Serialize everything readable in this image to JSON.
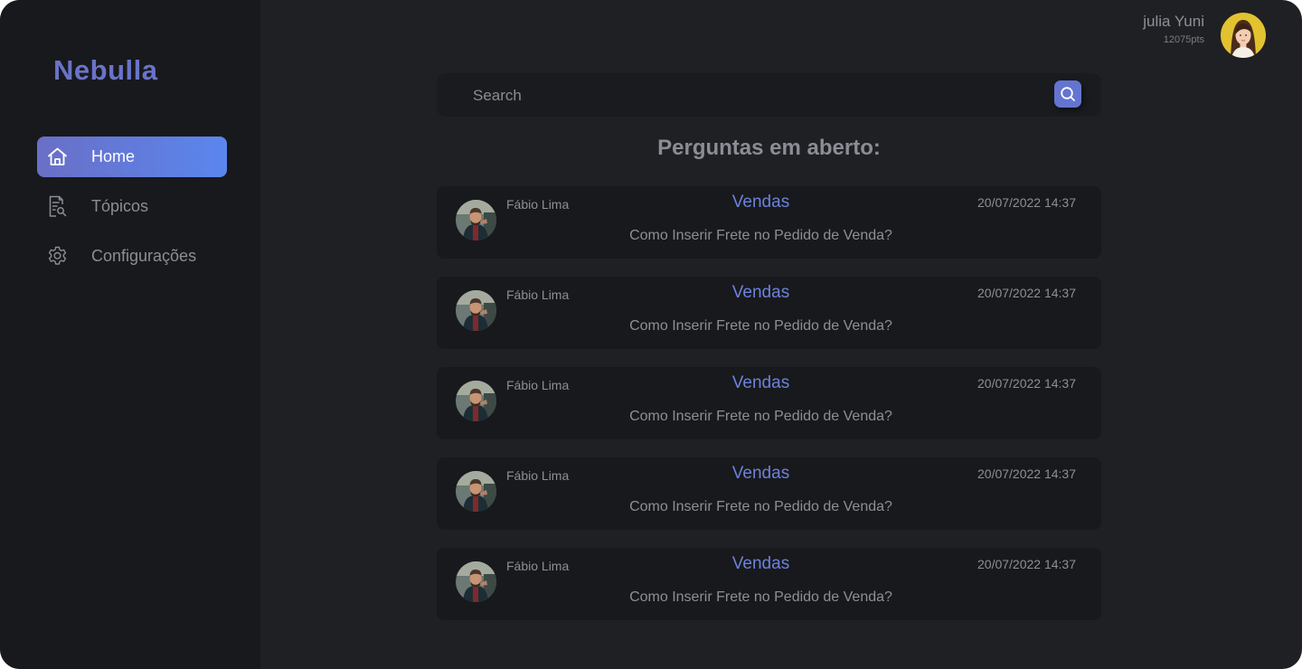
{
  "app": {
    "logo": "Nebulla"
  },
  "sidebar": {
    "items": [
      {
        "label": "Home",
        "icon": "home-icon",
        "active": true
      },
      {
        "label": "Tópicos",
        "icon": "document-search-icon",
        "active": false
      },
      {
        "label": "Configurações",
        "icon": "gear-icon",
        "active": false
      }
    ]
  },
  "user": {
    "name": "julia Yuni",
    "points": "12075pts"
  },
  "search": {
    "placeholder": "Search",
    "icon": "search-icon"
  },
  "main": {
    "section_title": "Perguntas em aberto:",
    "questions": [
      {
        "author": "Fábio Lima",
        "topic": "Vendas",
        "datetime": "20/07/2022 14:37",
        "question": "Como Inserir Frete no Pedido de Venda?"
      },
      {
        "author": "Fábio Lima",
        "topic": "Vendas",
        "datetime": "20/07/2022 14:37",
        "question": "Como Inserir Frete no Pedido de Venda?"
      },
      {
        "author": "Fábio Lima",
        "topic": "Vendas",
        "datetime": "20/07/2022 14:37",
        "question": "Como Inserir Frete no Pedido de Venda?"
      },
      {
        "author": "Fábio Lima",
        "topic": "Vendas",
        "datetime": "20/07/2022 14:37",
        "question": "Como Inserir Frete no Pedido de Venda?"
      },
      {
        "author": "Fábio Lima",
        "topic": "Vendas",
        "datetime": "20/07/2022 14:37",
        "question": "Como Inserir Frete no Pedido de Venda?"
      }
    ]
  },
  "colors": {
    "background": "#1f2024",
    "sidebar": "#18191c",
    "card": "#18191c",
    "accent": "#6c82dc",
    "active_gradient_start": "#6a6fc6",
    "active_gradient_end": "#5a86ee",
    "text_muted": "#8d8f97"
  }
}
